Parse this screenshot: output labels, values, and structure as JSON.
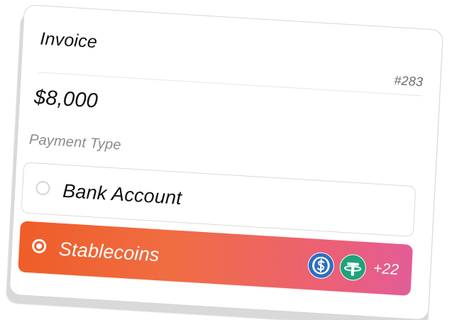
{
  "invoice": {
    "title": "Invoice",
    "number": "#283",
    "amount": "$8,000"
  },
  "payment": {
    "label": "Payment Type",
    "options": [
      {
        "label": "Bank Account",
        "selected": false
      },
      {
        "label": "Stablecoins",
        "selected": true,
        "coins": [
          {
            "name": "usdc-coin-icon",
            "color": "#2d6ec2"
          },
          {
            "name": "tether-coin-icon",
            "color": "#1ea37b"
          }
        ],
        "extra_count": "+22"
      }
    ]
  },
  "colors": {
    "selected_gradient_start": "#ef5d28",
    "selected_gradient_end": "#e25d98",
    "text_primary": "#111111",
    "text_muted": "#8a8a8a"
  }
}
